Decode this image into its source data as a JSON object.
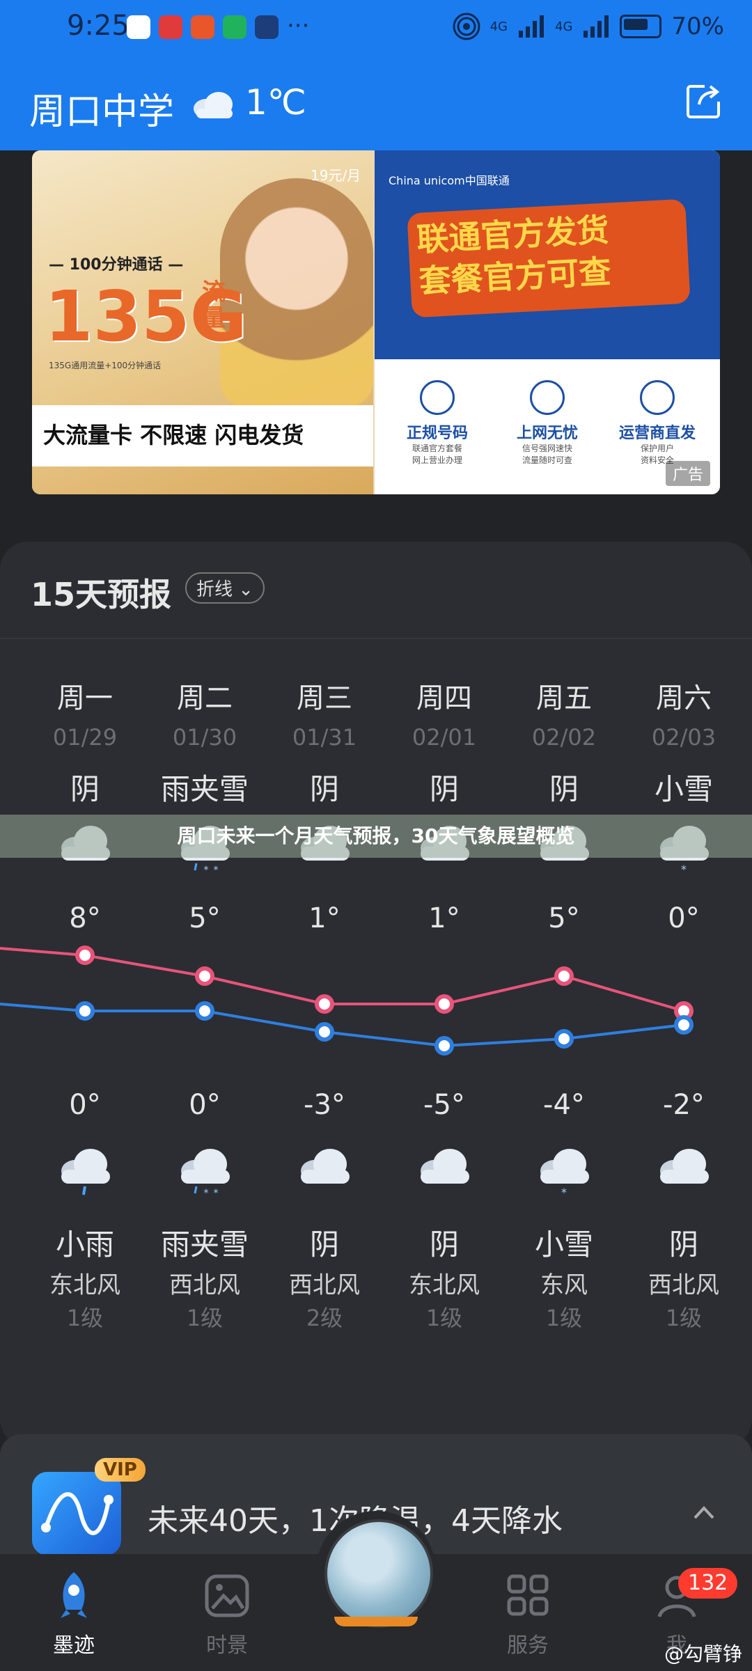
{
  "status_bar": {
    "time": "9:25",
    "signal1": "4G",
    "signal2": "4G",
    "battery": "70%"
  },
  "header": {
    "city": "周口中学",
    "temp": "1℃"
  },
  "ad": {
    "left_sub": "— 100分钟通话 —",
    "left_big": "135G",
    "left_flow": "流量",
    "left_small": "135G通用流量+100分钟通话",
    "left_price": "19元/月",
    "left_card": "大流量卡 不限速 闪电发货",
    "right_logo": "China unicom中国联通",
    "right_headline1": "联通官方发货",
    "right_headline2": "套餐官方可查",
    "features": [
      {
        "title": "正规号码",
        "desc1": "联通官方套餐",
        "desc2": "网上营业办理"
      },
      {
        "title": "上网无忧",
        "desc1": "信号强网速快",
        "desc2": "流量随时可查"
      },
      {
        "title": "运营商直发",
        "desc1": "保护用户",
        "desc2": "资料安全"
      }
    ],
    "tag": "广告"
  },
  "forecast": {
    "title": "15天预报",
    "mode": "折线",
    "days": [
      {
        "day": "周一",
        "date": "01/29",
        "cond": "阴",
        "hi": "8°",
        "lo": "0°",
        "night_cond": "小雨",
        "wind": "东北风",
        "level": "1级"
      },
      {
        "day": "周二",
        "date": "01/30",
        "cond": "雨夹雪",
        "hi": "5°",
        "lo": "0°",
        "night_cond": "雨夹雪",
        "wind": "西北风",
        "level": "1级"
      },
      {
        "day": "周三",
        "date": "01/31",
        "cond": "阴",
        "hi": "1°",
        "lo": "-3°",
        "night_cond": "阴",
        "wind": "西北风",
        "level": "2级"
      },
      {
        "day": "周四",
        "date": "02/01",
        "cond": "阴",
        "hi": "1°",
        "lo": "-5°",
        "night_cond": "阴",
        "wind": "东北风",
        "level": "1级"
      },
      {
        "day": "周五",
        "date": "02/02",
        "cond": "阴",
        "hi": "5°",
        "lo": "-4°",
        "night_cond": "小雪",
        "wind": "东风",
        "level": "1级"
      },
      {
        "day": "周六",
        "date": "02/03",
        "cond": "小雪",
        "hi": "0°",
        "lo": "-2°",
        "night_cond": "阴",
        "wind": "西北风",
        "level": "1级"
      }
    ],
    "high_temps": [
      8,
      5,
      1,
      1,
      5,
      0
    ],
    "low_temps": [
      0,
      0,
      -3,
      -5,
      -4,
      -2
    ],
    "colors": {
      "high_line": "#e8547a",
      "low_line": "#2f7fe0"
    }
  },
  "overlay_text": "周口未来一个月天气预报，30天气象展望概览",
  "vip": {
    "badge": "VIP",
    "text": "未来40天，1次降温，4天降水"
  },
  "nav": [
    {
      "label": "墨迹",
      "icon": "rocket-icon"
    },
    {
      "label": "时景",
      "icon": "image-icon"
    },
    {
      "label": "服务",
      "icon": "grid-icon"
    },
    {
      "label": "我",
      "icon": "profile-icon"
    }
  ],
  "badge": "132",
  "watermark": "@勾臂铮"
}
